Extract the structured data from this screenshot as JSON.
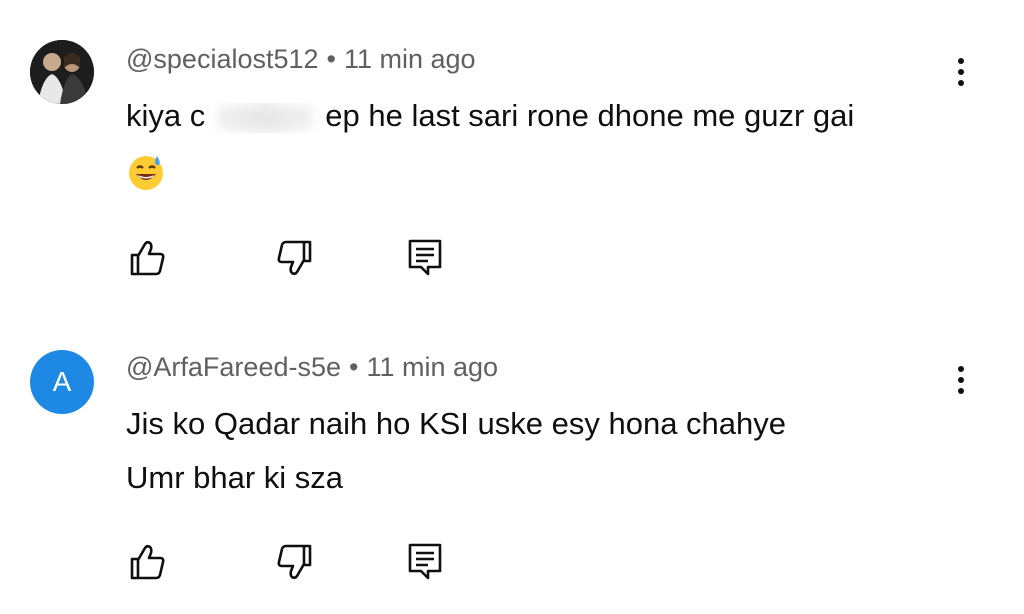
{
  "comments": [
    {
      "username": "@specialost512",
      "separator": "•",
      "time": "11 min ago",
      "text_before_redaction": "kiya c",
      "text_after_redaction": "ep he last sari rone dhone me guzr gai",
      "emoji": "😅",
      "avatar_icon": "profile-photo-avatar"
    },
    {
      "username": "@ArfaFareed-s5e",
      "separator": "•",
      "time": "11 min ago",
      "avatar_letter": "A",
      "avatar_color": "#1e88e5",
      "line1": "Jis ko Qadar naih ho KSI uske esy hona chahye",
      "line2": "Umr bhar ki sza"
    }
  ],
  "icons": {
    "like": "thumbs-up-icon",
    "dislike": "thumbs-down-icon",
    "reply": "reply-comment-icon",
    "more": "more-vertical-icon"
  },
  "colors": {
    "text": "#0f0f0f",
    "meta": "#606060",
    "avatar_blue": "#1e88e5"
  }
}
